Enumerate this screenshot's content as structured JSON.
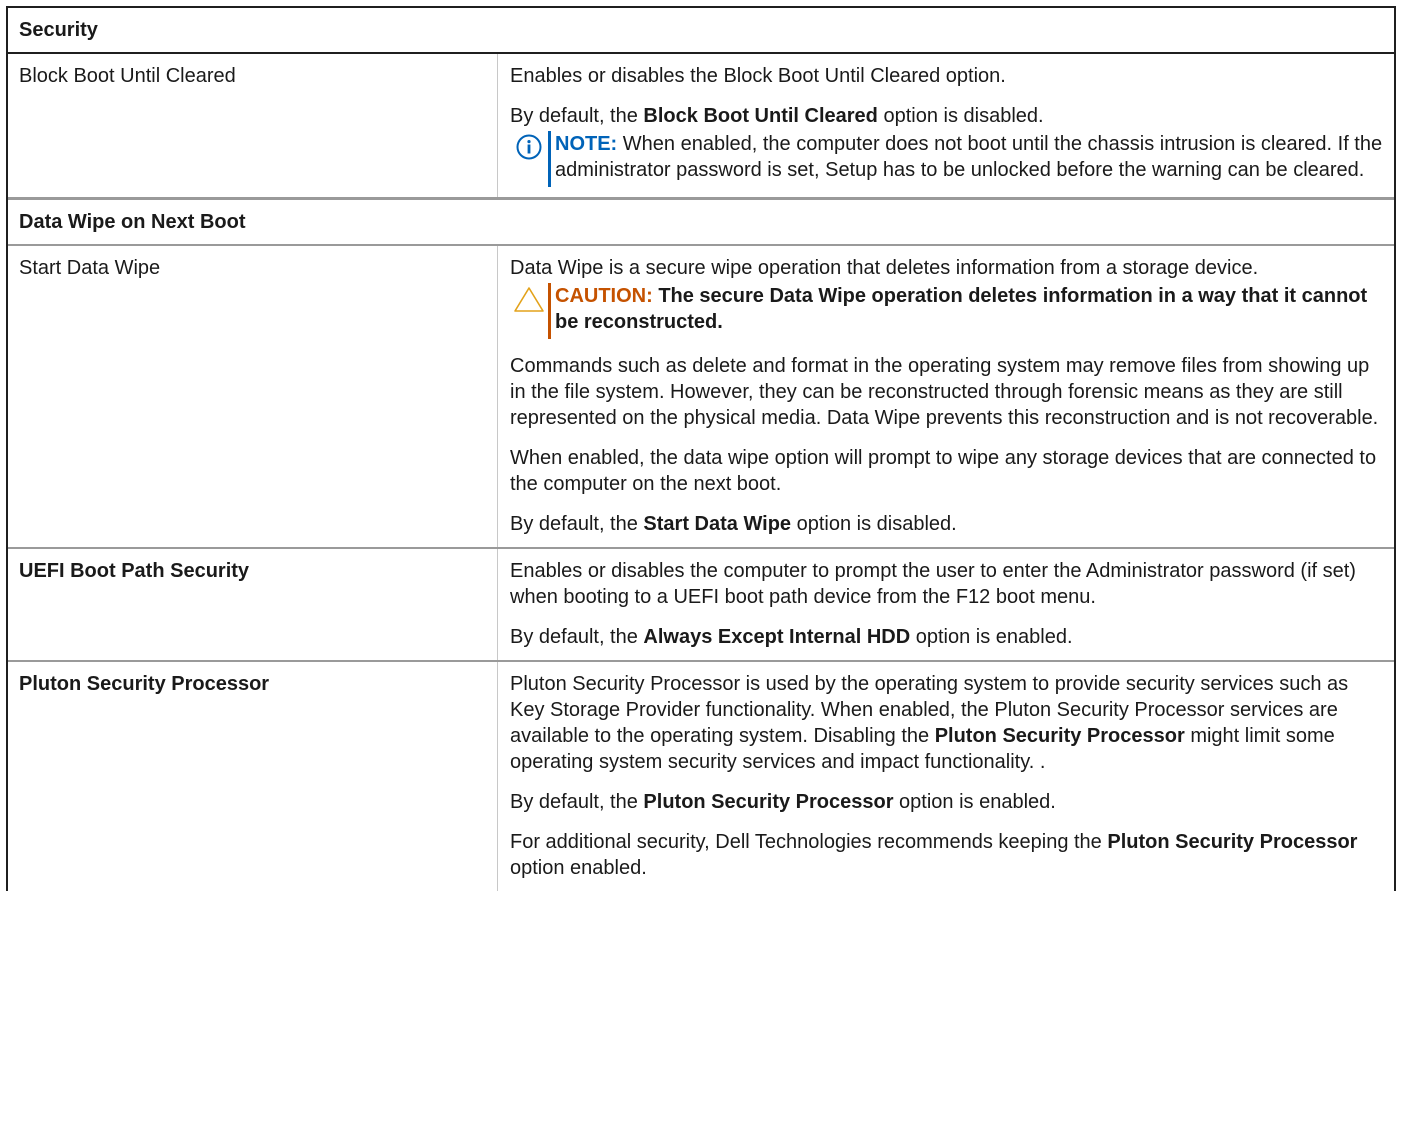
{
  "section_security": "Security",
  "block_boot": {
    "name": "Block Boot Until Cleared",
    "desc": "Enables or disables the Block Boot Until Cleared option.",
    "default_prefix": "By default, the ",
    "default_bold": "Block Boot Until Cleared",
    "default_suffix": " option is disabled.",
    "note_label": "NOTE:",
    "note_text": " When enabled, the computer does not boot until the chassis intrusion is cleared. If the administrator password is set, Setup has to be unlocked before the warning can be cleared."
  },
  "section_data_wipe": "Data Wipe on Next Boot",
  "start_data_wipe": {
    "name": "Start Data Wipe",
    "desc": "Data Wipe is a secure wipe operation that deletes information from a storage device.",
    "caution_label": "CAUTION:",
    "caution_text": " The secure Data Wipe operation deletes information in a way that it cannot be reconstructed.",
    "para2": "Commands such as delete and format in the operating system may remove files from showing up in the file system. However, they can be reconstructed through forensic means as they are still represented on the physical media. Data Wipe prevents this reconstruction and is not recoverable.",
    "para3": "When enabled, the data wipe option will prompt to wipe any storage devices that are connected to the computer on the next boot.",
    "default_prefix": "By default, the ",
    "default_bold": "Start Data Wipe",
    "default_suffix": " option is disabled."
  },
  "uefi_boot": {
    "name": "UEFI Boot Path Security",
    "desc": "Enables or disables the computer to prompt the user to enter the Administrator password (if set) when booting to a UEFI boot path device from the F12 boot menu.",
    "default_prefix": "By default, the ",
    "default_bold": "Always Except Internal HDD",
    "default_suffix": " option is enabled."
  },
  "pluton": {
    "name": "Pluton Security Processor",
    "desc_a": "Pluton Security Processor is used by the operating system to provide security services such as Key Storage Provider functionality. When enabled, the Pluton Security Processor services are available to the operating system. Disabling the ",
    "desc_bold": "Pluton Security Processor",
    "desc_b": " might limit some operating system security services and impact functionality. .",
    "default_prefix": "By default, the ",
    "default_bold": "Pluton Security Processor",
    "default_suffix": " option is enabled.",
    "rec_prefix": "For additional security, Dell Technologies recommends keeping the ",
    "rec_bold": "Pluton Security Processor",
    "rec_suffix": " option enabled."
  },
  "icons": {
    "note": "info-circle-icon",
    "caution": "warning-triangle-icon"
  },
  "colors": {
    "note": "#0063b8",
    "caution": "#c55200"
  }
}
